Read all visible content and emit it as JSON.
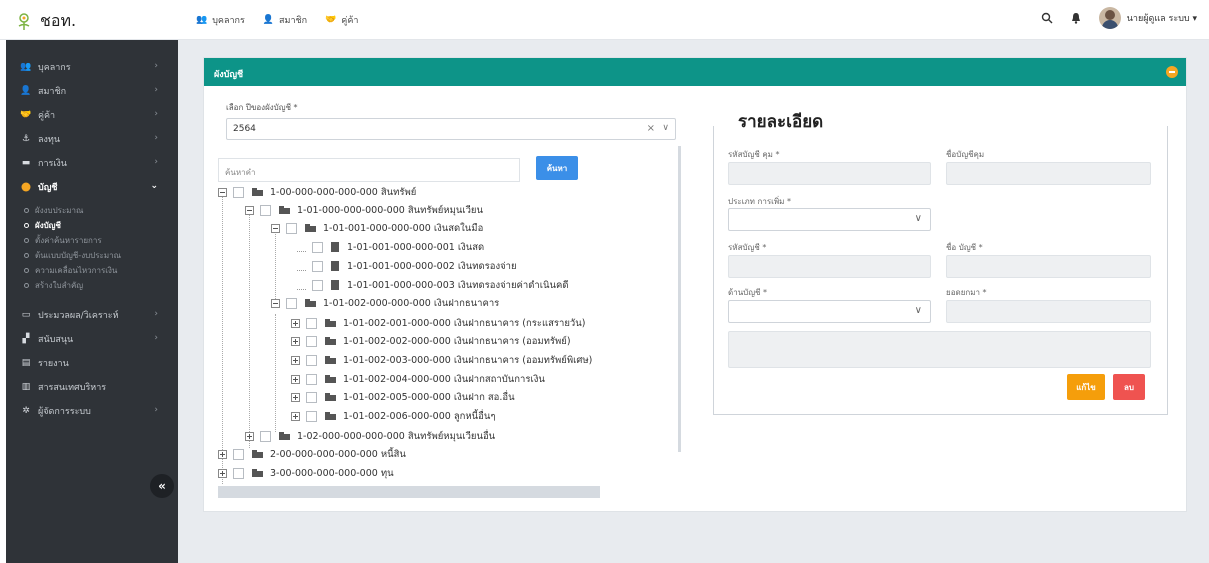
{
  "app": {
    "title": "ชอท."
  },
  "top_nav": [
    {
      "label": "บุคลากร",
      "icon": "people-icon"
    },
    {
      "label": "สมาชิก",
      "icon": "user-icon"
    },
    {
      "label": "คู่ค้า",
      "icon": "partners-icon"
    }
  ],
  "top_right": {
    "user_name": "นายผู้ดูแล ระบบ ▾"
  },
  "sidebar": {
    "items": [
      {
        "label": "บุคลากร",
        "icon": "people-icon"
      },
      {
        "label": "สมาชิก",
        "icon": "user-icon"
      },
      {
        "label": "คู่ค้า",
        "icon": "partners-icon"
      },
      {
        "label": "ลงทุน",
        "icon": "invest-icon"
      },
      {
        "label": "การเงิน",
        "icon": "money-icon"
      },
      {
        "label": "บัญชี",
        "icon": "account-icon"
      }
    ],
    "sub_items": [
      "ผังงบประมาณ",
      "ผังบัญชี",
      "ตั้งค่าค้นหารายการ",
      "ต้นแบบบัญชี-งบประมาณ",
      "ความเคลื่อนไหวการเงิน",
      "สร้างใบสำคัญ"
    ],
    "items2": [
      {
        "label": "ประมวลผล/วิเคราะห์",
        "icon": "process-icon"
      },
      {
        "label": "สนับสนุน",
        "icon": "support-icon"
      },
      {
        "label": "รายงาน",
        "icon": "report-icon"
      },
      {
        "label": "สารสนเทศบริหาร",
        "icon": "chart-icon"
      },
      {
        "label": "ผู้จัดการระบบ",
        "icon": "gear-icon"
      }
    ],
    "collapse_label": "«"
  },
  "card": {
    "title": "ผังบัญชี"
  },
  "year_select": {
    "label": "เลือก ปีของผังบัญชี *",
    "value": "2564"
  },
  "search": {
    "placeholder": "ค้นหาคำ",
    "button": "ค้นหา"
  },
  "tree": [
    "1-00-000-000-000-000 สินทรัพย์",
    "1-01-000-000-000-000 สินทรัพย์หมุนเวียน",
    "1-01-001-000-000-000 เงินสดในมือ",
    "1-01-001-000-000-001 เงินสด",
    "1-01-001-000-000-002 เงินทดรองจ่าย",
    "1-01-001-000-000-003 เงินทดรองจ่ายค่าดำเนินคดี",
    "1-01-002-000-000-000 เงินฝากธนาคาร",
    "1-01-002-001-000-000 เงินฝากธนาคาร (กระแสรายวัน)",
    "1-01-002-002-000-000 เงินฝากธนาคาร (ออมทรัพย์)",
    "1-01-002-003-000-000 เงินฝากธนาคาร (ออมทรัพย์พิเศษ)",
    "1-01-002-004-000-000 เงินฝากสถาบันการเงิน",
    "1-01-002-005-000-000 เงินฝาก สอ.อื่น",
    "1-01-002-006-000-000 ลูกหนี้อื่นๆ",
    "1-02-000-000-000-000 สินทรัพย์หมุนเวียนอื่น",
    "2-00-000-000-000-000 หนี้สิน",
    "3-00-000-000-000-000 ทุน"
  ],
  "detail": {
    "title": "รายละเอียด",
    "parent_code_label": "รหัสบัญชี คุม *",
    "parent_name_label": "ชื่อบัญชีคุม",
    "type_label": "ประเภท การเพิ่ม *",
    "code_label": "รหัสบัญชี *",
    "name_label": "ชื่อ บัญชี *",
    "side_label": "ด้านบัญชี *",
    "balance_label": "ยอดยกมา *",
    "edit_button": "แก้ไข",
    "delete_button": "ลบ"
  }
}
